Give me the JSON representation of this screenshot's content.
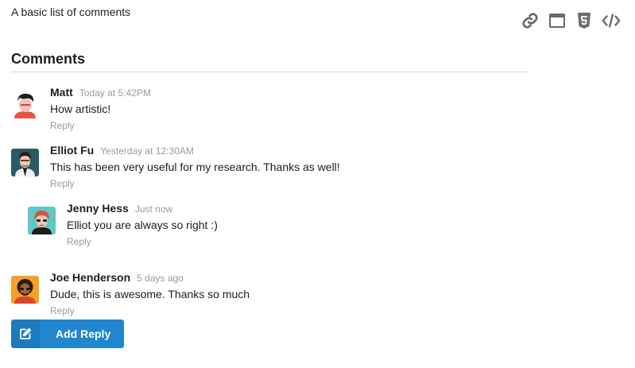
{
  "page": {
    "description": "A basic list of comments"
  },
  "toolbar": {
    "icons": [
      {
        "name": "link-icon"
      },
      {
        "name": "window-icon"
      },
      {
        "name": "html5-icon"
      },
      {
        "name": "code-icon"
      }
    ]
  },
  "comments": {
    "header": "Comments",
    "items": [
      {
        "author": "Matt",
        "date": "Today at 5:42PM",
        "text": "How artistic!",
        "reply": "Reply",
        "avatar_bg": "#ffffff"
      },
      {
        "author": "Elliot Fu",
        "date": "Yesterday at 12:30AM",
        "text": "This has been very useful for my research. Thanks as well!",
        "reply": "Reply",
        "avatar_bg": "#2a5a63"
      },
      {
        "author": "Jenny Hess",
        "date": "Just now",
        "text": "Elliot you are always so right :)",
        "reply": "Reply",
        "avatar_bg": "#5cc9c3",
        "nested": true
      },
      {
        "author": "Joe Henderson",
        "date": "5 days ago",
        "text": "Dude, this is awesome. Thanks so much",
        "reply": "Reply",
        "avatar_bg": "#f5a02a"
      }
    ]
  },
  "actions": {
    "add_reply_label": "Add Reply",
    "add_reply_icon": "edit-icon"
  },
  "colors": {
    "accent": "#2185d0",
    "muted_text": "#9a9a9a",
    "icon_gray": "#6b6b6b"
  }
}
